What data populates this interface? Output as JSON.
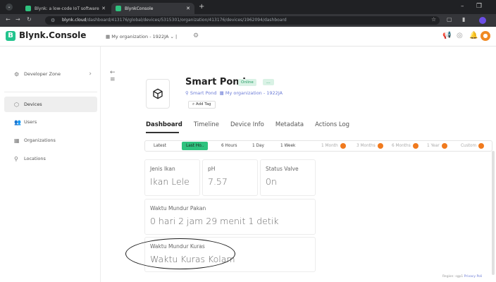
{
  "browser": {
    "tabs": [
      {
        "label": "Blynk: a low-code IoT software"
      },
      {
        "label": "BlynkConsole"
      }
    ],
    "url_prefix": "blynk.cloud",
    "url_path": "/dashboard/413176/global/devices/5315301/organization/413176/devices/1962094/dashboard"
  },
  "app": {
    "logo_letter": "B",
    "title": "Blynk.Console",
    "organization": "My organization - 1922JA"
  },
  "sidebar": {
    "items": [
      {
        "label": "Developer Zone",
        "icon": "robot-icon"
      },
      {
        "label": "Devices",
        "icon": "devices-icon"
      },
      {
        "label": "Users",
        "icon": "users-icon"
      },
      {
        "label": "Organizations",
        "icon": "building-icon"
      },
      {
        "label": "Locations",
        "icon": "location-icon"
      }
    ]
  },
  "device": {
    "name": "Smart Pond",
    "status": "Online",
    "more_label": "...",
    "template": "Smart Pond",
    "organization": "My organization - 1922JA",
    "add_tag": "Add Tag"
  },
  "tabs": [
    "Dashboard",
    "Timeline",
    "Device Info",
    "Metadata",
    "Actions Log"
  ],
  "time_ranges": {
    "latest": "Latest",
    "last_hour": "Last Ho..",
    "six_hours": "6 Hours",
    "one_day": "1 Day",
    "one_week": "1 Week",
    "one_month": "1 Month",
    "three_months": "3 Months",
    "six_months": "6 Months",
    "one_year": "1 Year",
    "custom": "Custom"
  },
  "widgets": {
    "jenis_ikan": {
      "label": "Jenis Ikan",
      "value": "Ikan Lele"
    },
    "ph": {
      "label": "pH",
      "value": "7.57"
    },
    "status_valve": {
      "label": "Status Valve",
      "value": "0n"
    },
    "pakan": {
      "label": "Waktu Mundur Pakan",
      "value": "0 hari 2 jam 29 menit 1 detik"
    },
    "kuras": {
      "label": "Waktu Mundur Kuras",
      "value": "Waktu Kuras Kolam"
    }
  },
  "footer": {
    "region": "Region: sgp1",
    "privacy": "Privacy Poli"
  },
  "colors": {
    "brand": "#23c48e",
    "active_range": "#2ec27e",
    "lock": "#f07a1e",
    "link": "#6b7bd6"
  }
}
